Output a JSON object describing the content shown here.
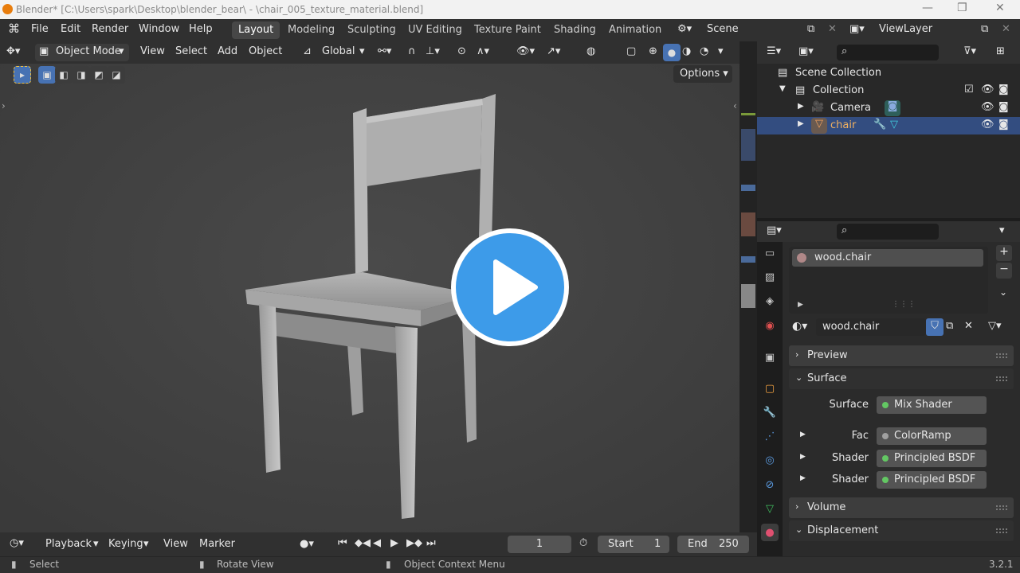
{
  "titlebar": {
    "text": "Blender* [C:\\Users\\spark\\Desktop\\blender_bear\\ - \\chair_005_texture_material.blend]"
  },
  "menu": {
    "file": "File",
    "edit": "Edit",
    "render": "Render",
    "window": "Window",
    "help": "Help"
  },
  "workspaces": [
    "Layout",
    "Modeling",
    "Sculpting",
    "UV Editing",
    "Texture Paint",
    "Shading",
    "Animation"
  ],
  "scene": {
    "name": "Scene",
    "view_layer": "ViewLayer"
  },
  "viewport": {
    "mode": "Object Mode",
    "menus": {
      "view": "View",
      "select": "Select",
      "add": "Add",
      "object": "Object"
    },
    "orientation": "Global",
    "options": "Options"
  },
  "timeline": {
    "playback": "Playback",
    "keying": "Keying",
    "view": "View",
    "marker": "Marker",
    "current_frame": "1",
    "start_label": "Start",
    "start": "1",
    "end_label": "End",
    "end": "250"
  },
  "statusbar": {
    "select": "Select",
    "rotate": "Rotate View",
    "context": "Object Context Menu",
    "version": "3.2.1"
  },
  "outliner": {
    "scene_collection": "Scene Collection",
    "collection": "Collection",
    "camera": "Camera",
    "chair": "chair"
  },
  "properties": {
    "material_slot": "wood.chair",
    "material_name": "wood.chair",
    "panels": {
      "preview": "Preview",
      "surface": "Surface",
      "volume": "Volume",
      "displacement": "Displacement"
    },
    "surface_label": "Surface",
    "surface_value": "Mix Shader",
    "fac_label": "Fac",
    "fac_value": "ColorRamp",
    "shader1_label": "Shader",
    "shader1_value": "Principled BSDF",
    "shader2_label": "Shader",
    "shader2_value": "Principled BSDF"
  },
  "colors": {
    "accent": "#4772b3",
    "selection": "#334d80",
    "play_button": "#3d9be9",
    "socket_green": "#63c763"
  }
}
